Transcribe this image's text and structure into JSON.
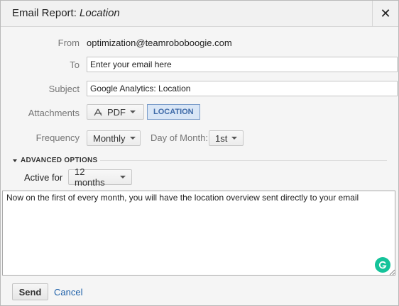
{
  "dialog": {
    "title_prefix": "Email Report:",
    "title_report": "Location",
    "close_glyph": "✕"
  },
  "form": {
    "from_label": "From",
    "from_value": "optimization@teamroboboogie.com",
    "to_label": "To",
    "to_value": "Enter your email here",
    "subject_label": "Subject",
    "subject_value": "Google Analytics: Location",
    "attachments_label": "Attachments",
    "attachment_format": "PDF",
    "attachment_tag": "LOCATION",
    "frequency_label": "Frequency",
    "frequency_value": "Monthly",
    "day_of_month_label": "Day of Month:",
    "day_of_month_value": "1st"
  },
  "advanced": {
    "toggle_label": "ADVANCED OPTIONS",
    "active_for_label": "Active for",
    "active_for_value": "12 months"
  },
  "message": {
    "text": "Now on the first of every month, you will have the location overview sent directly to your email"
  },
  "footer": {
    "send_label": "Send",
    "cancel_label": "Cancel"
  },
  "colors": {
    "tag_border": "#7a9cc9",
    "tag_text": "#3e6aa8",
    "link": "#1a5ea8",
    "grammarly": "#15c39a"
  },
  "icons": {
    "pdf": "pdf-icon",
    "close": "close-icon",
    "caret": "chevron-down-icon",
    "grammarly": "grammarly-icon"
  }
}
